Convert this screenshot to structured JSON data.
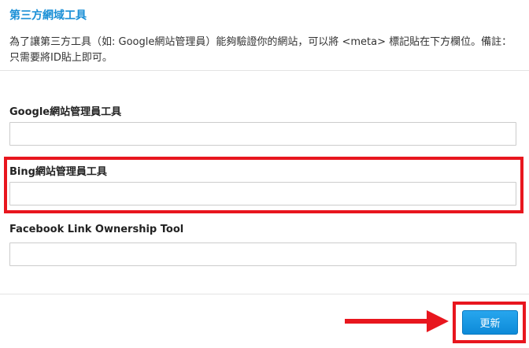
{
  "section": {
    "title": "第三方網域工具",
    "description": "為了讓第三方工具（如: Google網站管理員）能夠驗證你的網站，可以將 <meta> 標記貼在下方欄位。備註：只需要將ID貼上即可。"
  },
  "fields": {
    "google": {
      "label": "Google網站管理員工具",
      "value": "",
      "placeholder": ""
    },
    "bing": {
      "label": "Bing網站管理員工具",
      "value": "",
      "placeholder": ""
    },
    "facebook": {
      "label": "Facebook Link Ownership Tool",
      "value": "",
      "placeholder": ""
    }
  },
  "actions": {
    "update_label": "更新"
  },
  "colors": {
    "accent": "#1a8fd6",
    "highlight": "#e8161e",
    "button": "#1b98e3"
  }
}
